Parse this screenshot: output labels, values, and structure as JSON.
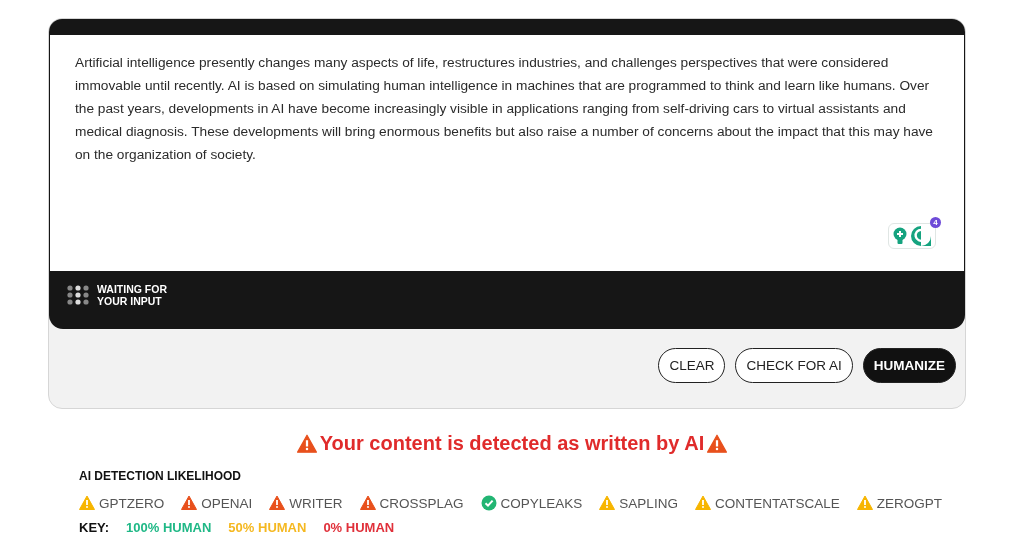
{
  "editor": {
    "value": "Artificial intelligence presently changes many aspects of life, restructures industries, and challenges perspectives that were considered immovable until recently. AI is based on simulating human intelligence in machines that are programmed to think and learn like humans. Over the past years, developments in AI have become increasingly visible in applications ranging from self-driving cars to virtual assistants and medical diagnosis. These developments will bring enormous benefits but also raise a number of concerns about the impact that this may have on the organization of society.",
    "assistant_badge": "4"
  },
  "status": "WAITING FOR YOUR INPUT",
  "buttons": [
    {
      "label": "CLEAR",
      "primary": false
    },
    {
      "label": "CHECK FOR AI",
      "primary": false
    },
    {
      "label": "HUMANIZE",
      "primary": true
    }
  ],
  "verdict": "Your content is detected as written by AI",
  "likelihood_title": "AI DETECTION LIKELIHOOD",
  "detectors": [
    {
      "name": "GPTZERO",
      "kind": "warning",
      "color": "#f7b500"
    },
    {
      "name": "OPENAI",
      "kind": "warning",
      "color": "#e8501c"
    },
    {
      "name": "WRITER",
      "kind": "warning",
      "color": "#e8501c"
    },
    {
      "name": "CROSSPLAG",
      "kind": "warning",
      "color": "#e8501c"
    },
    {
      "name": "COPYLEAKS",
      "kind": "check",
      "color": "#22b573"
    },
    {
      "name": "SAPLING",
      "kind": "warning",
      "color": "#f7b500"
    },
    {
      "name": "CONTENTATSCALE",
      "kind": "warning",
      "color": "#f7b500"
    },
    {
      "name": "ZEROGPT",
      "kind": "warning",
      "color": "#f7b500"
    }
  ],
  "key": {
    "label": "KEY:",
    "items": [
      {
        "text": "100% HUMAN",
        "color": "#1fb886"
      },
      {
        "text": "50% HUMAN",
        "color": "#f5b820"
      },
      {
        "text": "0% HUMAN",
        "color": "#e0303a"
      }
    ]
  }
}
